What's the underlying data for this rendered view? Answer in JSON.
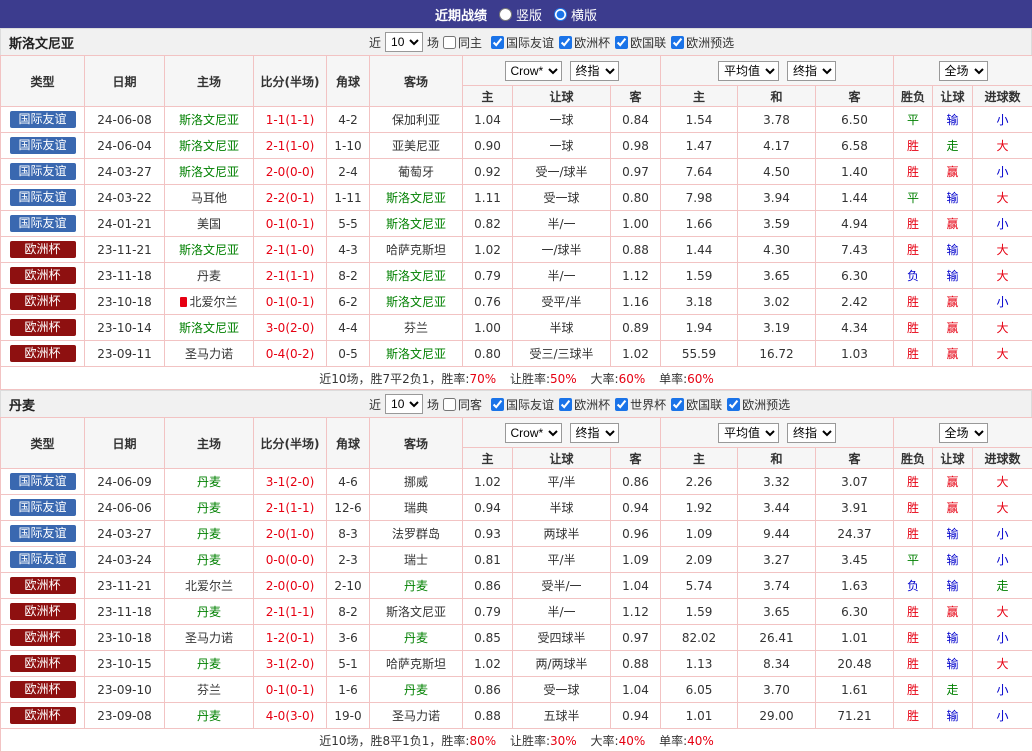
{
  "topbar": {
    "title": "近期战绩",
    "radios": [
      {
        "label": "竖版",
        "checked": false
      },
      {
        "label": "横版",
        "checked": true
      }
    ]
  },
  "columns": {
    "type": "类型",
    "date": "日期",
    "home": "主场",
    "score": "比分(半场)",
    "corner": "角球",
    "away": "客场",
    "h": "主",
    "hcp": "让球",
    "a": "客",
    "avg_h": "主",
    "avg_d": "和",
    "avg_a": "客",
    "result": "胜负",
    "hcp_result": "让球",
    "goals": "进球数"
  },
  "selects": {
    "odds_source": "Crow*",
    "final_odds_1": "终指",
    "avg_source": "平均值",
    "final_odds_2": "终指",
    "scope": "全场"
  },
  "filter_labels": {
    "prefix": "近",
    "suffix": "场"
  },
  "colors": {
    "topbar_bg": "#3c3c8e",
    "friendly_badge": "#3a68b0",
    "euro_badge": "#8e1010",
    "win_red": "#e60012",
    "draw_green": "#008000",
    "lose_blue": "#0000cc",
    "table_border": "#f2c3c3"
  },
  "sections": [
    {
      "team": "斯洛文尼亚",
      "filter": {
        "count": "10",
        "venue_label": "同主",
        "venue_checked": false,
        "leagues": [
          {
            "label": "国际友谊",
            "checked": true
          },
          {
            "label": "欧洲杯",
            "checked": true
          },
          {
            "label": "欧国联",
            "checked": true
          },
          {
            "label": "欧洲预选",
            "checked": true
          }
        ]
      },
      "rows": [
        {
          "league": "国际友谊",
          "lt": "friendly",
          "date": "24-06-08",
          "home": "斯洛文尼亚",
          "hf": true,
          "hicon": false,
          "score": "1-1(1-1)",
          "corner": "4-2",
          "away": "保加利亚",
          "af": false,
          "oh": "1.04",
          "hcp": "一球",
          "oa": "0.84",
          "ah": "1.54",
          "ad": "3.78",
          "aa": "6.50",
          "res": [
            "平",
            "green"
          ],
          "hres": [
            "输",
            "blue"
          ],
          "gres": [
            "小",
            "blue"
          ]
        },
        {
          "league": "国际友谊",
          "lt": "friendly",
          "date": "24-06-04",
          "home": "斯洛文尼亚",
          "hf": true,
          "hicon": false,
          "score": "2-1(1-0)",
          "corner": "1-10",
          "away": "亚美尼亚",
          "af": false,
          "oh": "0.90",
          "hcp": "一球",
          "oa": "0.98",
          "ah": "1.47",
          "ad": "4.17",
          "aa": "6.58",
          "res": [
            "胜",
            "red"
          ],
          "hres": [
            "走",
            "green"
          ],
          "gres": [
            "大",
            "red"
          ]
        },
        {
          "league": "国际友谊",
          "lt": "friendly",
          "date": "24-03-27",
          "home": "斯洛文尼亚",
          "hf": true,
          "hicon": false,
          "score": "2-0(0-0)",
          "corner": "2-4",
          "away": "葡萄牙",
          "af": false,
          "oh": "0.92",
          "hcp": "受一/球半",
          "oa": "0.97",
          "ah": "7.64",
          "ad": "4.50",
          "aa": "1.40",
          "res": [
            "胜",
            "red"
          ],
          "hres": [
            "赢",
            "red"
          ],
          "gres": [
            "小",
            "blue"
          ]
        },
        {
          "league": "国际友谊",
          "lt": "friendly",
          "date": "24-03-22",
          "home": "马耳他",
          "hf": false,
          "hicon": false,
          "score": "2-2(0-1)",
          "corner": "1-11",
          "away": "斯洛文尼亚",
          "af": true,
          "oh": "1.11",
          "hcp": "受一球",
          "oa": "0.80",
          "ah": "7.98",
          "ad": "3.94",
          "aa": "1.44",
          "res": [
            "平",
            "green"
          ],
          "hres": [
            "输",
            "blue"
          ],
          "gres": [
            "大",
            "red"
          ]
        },
        {
          "league": "国际友谊",
          "lt": "friendly",
          "date": "24-01-21",
          "home": "美国",
          "hf": false,
          "hicon": false,
          "score": "0-1(0-1)",
          "corner": "5-5",
          "away": "斯洛文尼亚",
          "af": true,
          "oh": "0.82",
          "hcp": "半/一",
          "oa": "1.00",
          "ah": "1.66",
          "ad": "3.59",
          "aa": "4.94",
          "res": [
            "胜",
            "red"
          ],
          "hres": [
            "赢",
            "red"
          ],
          "gres": [
            "小",
            "blue"
          ]
        },
        {
          "league": "欧洲杯",
          "lt": "euro",
          "date": "23-11-21",
          "home": "斯洛文尼亚",
          "hf": true,
          "hicon": false,
          "score": "2-1(1-0)",
          "corner": "4-3",
          "away": "哈萨克斯坦",
          "af": false,
          "oh": "1.02",
          "hcp": "一/球半",
          "oa": "0.88",
          "ah": "1.44",
          "ad": "4.30",
          "aa": "7.43",
          "res": [
            "胜",
            "red"
          ],
          "hres": [
            "输",
            "blue"
          ],
          "gres": [
            "大",
            "red"
          ]
        },
        {
          "league": "欧洲杯",
          "lt": "euro",
          "date": "23-11-18",
          "home": "丹麦",
          "hf": false,
          "hicon": false,
          "score": "2-1(1-1)",
          "corner": "8-2",
          "away": "斯洛文尼亚",
          "af": true,
          "oh": "0.79",
          "hcp": "半/一",
          "oa": "1.12",
          "ah": "1.59",
          "ad": "3.65",
          "aa": "6.30",
          "res": [
            "负",
            "blue"
          ],
          "hres": [
            "输",
            "blue"
          ],
          "gres": [
            "大",
            "red"
          ]
        },
        {
          "league": "欧洲杯",
          "lt": "euro",
          "date": "23-10-18",
          "home": "北爱尔兰",
          "hf": false,
          "hicon": true,
          "score": "0-1(0-1)",
          "corner": "6-2",
          "away": "斯洛文尼亚",
          "af": true,
          "oh": "0.76",
          "hcp": "受平/半",
          "oa": "1.16",
          "ah": "3.18",
          "ad": "3.02",
          "aa": "2.42",
          "res": [
            "胜",
            "red"
          ],
          "hres": [
            "赢",
            "red"
          ],
          "gres": [
            "小",
            "blue"
          ]
        },
        {
          "league": "欧洲杯",
          "lt": "euro",
          "date": "23-10-14",
          "home": "斯洛文尼亚",
          "hf": true,
          "hicon": false,
          "score": "3-0(2-0)",
          "corner": "4-4",
          "away": "芬兰",
          "af": false,
          "oh": "1.00",
          "hcp": "半球",
          "oa": "0.89",
          "ah": "1.94",
          "ad": "3.19",
          "aa": "4.34",
          "res": [
            "胜",
            "red"
          ],
          "hres": [
            "赢",
            "red"
          ],
          "gres": [
            "大",
            "red"
          ]
        },
        {
          "league": "欧洲杯",
          "lt": "euro",
          "date": "23-09-11",
          "home": "圣马力诺",
          "hf": false,
          "hicon": false,
          "score": "0-4(0-2)",
          "corner": "0-5",
          "away": "斯洛文尼亚",
          "af": true,
          "oh": "0.80",
          "hcp": "受三/三球半",
          "oa": "1.02",
          "ah": "55.59",
          "ad": "16.72",
          "aa": "1.03",
          "res": [
            "胜",
            "red"
          ],
          "hres": [
            "赢",
            "red"
          ],
          "gres": [
            "大",
            "red"
          ]
        }
      ],
      "summary": {
        "games": "近10场，胜7平2负1，胜率:",
        "win_rate": "70%",
        "hcp_label": "让胜率:",
        "hcp_rate": "50%",
        "big_label": "大率:",
        "big_rate": "60%",
        "odd_label": "单率:",
        "odd_rate": "60%"
      }
    },
    {
      "team": "丹麦",
      "filter": {
        "count": "10",
        "venue_label": "同客",
        "venue_checked": false,
        "leagues": [
          {
            "label": "国际友谊",
            "checked": true
          },
          {
            "label": "欧洲杯",
            "checked": true
          },
          {
            "label": "世界杯",
            "checked": true
          },
          {
            "label": "欧国联",
            "checked": true
          },
          {
            "label": "欧洲预选",
            "checked": true
          }
        ]
      },
      "rows": [
        {
          "league": "国际友谊",
          "lt": "friendly",
          "date": "24-06-09",
          "home": "丹麦",
          "hf": true,
          "hicon": false,
          "score": "3-1(2-0)",
          "corner": "4-6",
          "away": "挪威",
          "af": false,
          "oh": "1.02",
          "hcp": "平/半",
          "oa": "0.86",
          "ah": "2.26",
          "ad": "3.32",
          "aa": "3.07",
          "res": [
            "胜",
            "red"
          ],
          "hres": [
            "赢",
            "red"
          ],
          "gres": [
            "大",
            "red"
          ]
        },
        {
          "league": "国际友谊",
          "lt": "friendly",
          "date": "24-06-06",
          "home": "丹麦",
          "hf": true,
          "hicon": false,
          "score": "2-1(1-1)",
          "corner": "12-6",
          "away": "瑞典",
          "af": false,
          "oh": "0.94",
          "hcp": "半球",
          "oa": "0.94",
          "ah": "1.92",
          "ad": "3.44",
          "aa": "3.91",
          "res": [
            "胜",
            "red"
          ],
          "hres": [
            "赢",
            "red"
          ],
          "gres": [
            "大",
            "red"
          ]
        },
        {
          "league": "国际友谊",
          "lt": "friendly",
          "date": "24-03-27",
          "home": "丹麦",
          "hf": true,
          "hicon": false,
          "score": "2-0(1-0)",
          "corner": "8-3",
          "away": "法罗群岛",
          "af": false,
          "oh": "0.93",
          "hcp": "两球半",
          "oa": "0.96",
          "ah": "1.09",
          "ad": "9.44",
          "aa": "24.37",
          "res": [
            "胜",
            "red"
          ],
          "hres": [
            "输",
            "blue"
          ],
          "gres": [
            "小",
            "blue"
          ]
        },
        {
          "league": "国际友谊",
          "lt": "friendly",
          "date": "24-03-24",
          "home": "丹麦",
          "hf": true,
          "hicon": false,
          "score": "0-0(0-0)",
          "corner": "2-3",
          "away": "瑞士",
          "af": false,
          "oh": "0.81",
          "hcp": "平/半",
          "oa": "1.09",
          "ah": "2.09",
          "ad": "3.27",
          "aa": "3.45",
          "res": [
            "平",
            "green"
          ],
          "hres": [
            "输",
            "blue"
          ],
          "gres": [
            "小",
            "blue"
          ]
        },
        {
          "league": "欧洲杯",
          "lt": "euro",
          "date": "23-11-21",
          "home": "北爱尔兰",
          "hf": false,
          "hicon": false,
          "score": "2-0(0-0)",
          "corner": "2-10",
          "away": "丹麦",
          "af": true,
          "oh": "0.86",
          "hcp": "受半/一",
          "oa": "1.04",
          "ah": "5.74",
          "ad": "3.74",
          "aa": "1.63",
          "res": [
            "负",
            "blue"
          ],
          "hres": [
            "输",
            "blue"
          ],
          "gres": [
            "走",
            "green"
          ]
        },
        {
          "league": "欧洲杯",
          "lt": "euro",
          "date": "23-11-18",
          "home": "丹麦",
          "hf": true,
          "hicon": false,
          "score": "2-1(1-1)",
          "corner": "8-2",
          "away": "斯洛文尼亚",
          "af": false,
          "oh": "0.79",
          "hcp": "半/一",
          "oa": "1.12",
          "ah": "1.59",
          "ad": "3.65",
          "aa": "6.30",
          "res": [
            "胜",
            "red"
          ],
          "hres": [
            "赢",
            "red"
          ],
          "gres": [
            "大",
            "red"
          ]
        },
        {
          "league": "欧洲杯",
          "lt": "euro",
          "date": "23-10-18",
          "home": "圣马力诺",
          "hf": false,
          "hicon": false,
          "score": "1-2(0-1)",
          "corner": "3-6",
          "away": "丹麦",
          "af": true,
          "oh": "0.85",
          "hcp": "受四球半",
          "oa": "0.97",
          "ah": "82.02",
          "ad": "26.41",
          "aa": "1.01",
          "res": [
            "胜",
            "red"
          ],
          "hres": [
            "输",
            "blue"
          ],
          "gres": [
            "小",
            "blue"
          ]
        },
        {
          "league": "欧洲杯",
          "lt": "euro",
          "date": "23-10-15",
          "home": "丹麦",
          "hf": true,
          "hicon": false,
          "score": "3-1(2-0)",
          "corner": "5-1",
          "away": "哈萨克斯坦",
          "af": false,
          "oh": "1.02",
          "hcp": "两/两球半",
          "oa": "0.88",
          "ah": "1.13",
          "ad": "8.34",
          "aa": "20.48",
          "res": [
            "胜",
            "red"
          ],
          "hres": [
            "输",
            "blue"
          ],
          "gres": [
            "大",
            "red"
          ]
        },
        {
          "league": "欧洲杯",
          "lt": "euro",
          "date": "23-09-10",
          "home": "芬兰",
          "hf": false,
          "hicon": false,
          "score": "0-1(0-1)",
          "corner": "1-6",
          "away": "丹麦",
          "af": true,
          "oh": "0.86",
          "hcp": "受一球",
          "oa": "1.04",
          "ah": "6.05",
          "ad": "3.70",
          "aa": "1.61",
          "res": [
            "胜",
            "red"
          ],
          "hres": [
            "走",
            "green"
          ],
          "gres": [
            "小",
            "blue"
          ]
        },
        {
          "league": "欧洲杯",
          "lt": "euro",
          "date": "23-09-08",
          "home": "丹麦",
          "hf": true,
          "hicon": false,
          "score": "4-0(3-0)",
          "corner": "19-0",
          "away": "圣马力诺",
          "af": false,
          "oh": "0.88",
          "hcp": "五球半",
          "oa": "0.94",
          "ah": "1.01",
          "ad": "29.00",
          "aa": "71.21",
          "res": [
            "胜",
            "red"
          ],
          "hres": [
            "输",
            "blue"
          ],
          "gres": [
            "小",
            "blue"
          ]
        }
      ],
      "summary": {
        "games": "近10场，胜8平1负1，胜率:",
        "win_rate": "80%",
        "hcp_label": "让胜率:",
        "hcp_rate": "30%",
        "big_label": "大率:",
        "big_rate": "40%",
        "odd_label": "单率:",
        "odd_rate": "40%"
      }
    }
  ]
}
